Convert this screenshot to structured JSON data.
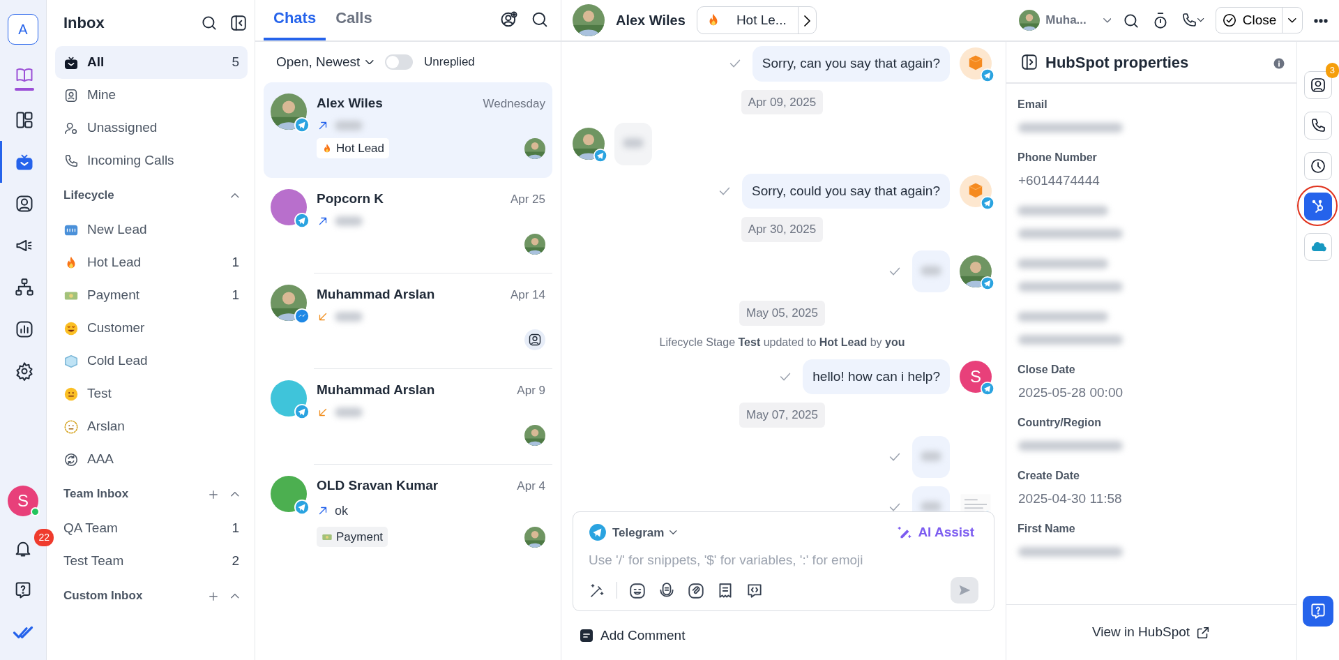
{
  "rail": {
    "workspace": "A",
    "items": [
      {
        "selected": false
      },
      {
        "selected": false
      },
      {
        "selected": true
      },
      {
        "selected": false
      },
      {
        "selected": false
      },
      {
        "selected": false
      },
      {
        "selected": false
      },
      {
        "selected": false
      }
    ],
    "user": {
      "letter": "S",
      "online": true
    },
    "notifications": "22"
  },
  "inbox": {
    "title": "Inbox",
    "items": [
      {
        "label": "All",
        "count": "5",
        "selected": true
      },
      {
        "label": "Mine",
        "selected": false
      },
      {
        "label": "Unassigned",
        "selected": false
      },
      {
        "label": "Incoming Calls",
        "selected": false
      }
    ],
    "sections": [
      {
        "title": "Lifecycle",
        "expanded": true,
        "items": [
          {
            "label": "New Lead",
            "selected": false
          },
          {
            "label": "Hot Lead",
            "count": "1",
            "selected": false
          },
          {
            "label": "Payment",
            "count": "1",
            "selected": false
          },
          {
            "label": "Customer",
            "selected": false
          },
          {
            "label": "Cold Lead",
            "selected": false
          },
          {
            "label": "Test",
            "selected": false
          },
          {
            "label": "Arslan",
            "selected": false
          },
          {
            "label": "AAA",
            "selected": false
          }
        ]
      },
      {
        "title": "Team Inbox",
        "addable": true,
        "expanded": true,
        "items": [
          {
            "label": "QA Team",
            "count": "1",
            "selected": false
          },
          {
            "label": "Test Team",
            "count": "2",
            "selected": false
          }
        ]
      },
      {
        "title": "Custom Inbox",
        "addable": true,
        "expanded": true
      }
    ]
  },
  "chat_list": {
    "tabs": [
      {
        "label": "Chats",
        "selected": true
      },
      {
        "label": "Calls",
        "selected": false
      }
    ],
    "filter": "Open, Newest",
    "unreplied": {
      "label": "Unreplied",
      "on": false
    },
    "chats": [
      {
        "name": "Alex Wiles",
        "time": "Wednesday",
        "avatar": {
          "kind": "photo"
        },
        "incoming": false,
        "preview_blurred": true,
        "tag": {
          "label": "Hot Lead"
        },
        "selected": true
      },
      {
        "name": "Popcorn K",
        "time": "Apr 25",
        "avatar": {
          "kind": "plain",
          "color": "#b86fcc"
        },
        "incoming": false,
        "preview_blurred": true,
        "selected": false
      },
      {
        "name": "Muhammad Arslan",
        "time": "Apr 14",
        "avatar": {
          "kind": "photo"
        },
        "incoming": true,
        "preview_blurred": true,
        "selected": false
      },
      {
        "name": "Muhammad Arslan",
        "time": "Apr 9",
        "avatar": {
          "kind": "plain",
          "color": "#3fc4da"
        },
        "incoming": true,
        "preview_blurred": true,
        "selected": false
      },
      {
        "name": "OLD Sravan Kumar",
        "time": "Apr 4",
        "avatar": {
          "kind": "plain",
          "color": "#4caf50"
        },
        "incoming": false,
        "preview": "ok",
        "tag": {
          "label": "Payment"
        },
        "selected": false
      }
    ]
  },
  "conversation": {
    "contact": "Alex Wiles",
    "lifecycle": {
      "label": "Hot Le..."
    },
    "assignee": "Muha...",
    "close": "Close",
    "messages": [
      {
        "kind": "message",
        "incoming": false,
        "text": "Sorry, can you say that again?"
      },
      {
        "kind": "date",
        "text": "Apr 09, 2025"
      },
      {
        "kind": "message",
        "incoming": true,
        "blurred": true
      },
      {
        "kind": "message",
        "incoming": false,
        "text": "Sorry, could you say that again?"
      },
      {
        "kind": "date",
        "text": "Apr 30, 2025"
      },
      {
        "kind": "message",
        "incoming": false,
        "blurred": true
      },
      {
        "kind": "date",
        "text": "May 05, 2025"
      },
      {
        "kind": "system",
        "text": "Lifecycle Stage **Test** updated to **Hot Lead** by **you**"
      },
      {
        "kind": "message",
        "incoming": false,
        "text": "hello! how can i help?",
        "letter": "S"
      },
      {
        "kind": "date",
        "text": "May 07, 2025"
      },
      {
        "kind": "message",
        "incoming": false,
        "blurred": true
      },
      {
        "kind": "message",
        "incoming": false,
        "blurred": true
      }
    ],
    "composer": {
      "channel": "Telegram",
      "ai": "AI Assist",
      "placeholder": "Use '/' for snippets, '$' for variables, ':' for emoji"
    },
    "add_comment": "Add Comment"
  },
  "properties": {
    "title": "HubSpot properties",
    "fields": [
      {
        "label": "Email",
        "value_blurred": true
      },
      {
        "label": "Phone Number",
        "value": "+6014474444"
      },
      {
        "label_blurred": true,
        "value_blurred": true
      },
      {
        "label_blurred": true,
        "value_blurred": true
      },
      {
        "label_blurred": true,
        "value_blurred": true
      },
      {
        "label": "Close Date",
        "value": "2025-05-28 00:00"
      },
      {
        "label": "Country/Region",
        "value_blurred": true
      },
      {
        "label": "Create Date",
        "value": "2025-04-30 11:58"
      },
      {
        "label": "First Name",
        "value_blurred": true
      }
    ],
    "link": "View in HubSpot"
  },
  "side_rail": {
    "items": [
      {
        "badge": "3",
        "selected": false
      },
      {
        "selected": false
      },
      {
        "selected": false
      },
      {
        "selected": true,
        "circled": true
      },
      {
        "selected": false
      }
    ]
  }
}
